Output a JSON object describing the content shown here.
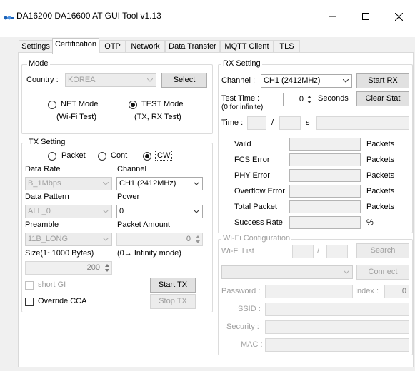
{
  "window": {
    "title": "DA16200 DA16600 AT GUI Tool v1.13",
    "logo_text": "dialog",
    "minimize": "minimize-icon",
    "maximize": "maximize-icon",
    "close": "close-icon"
  },
  "tabs": [
    "Settings",
    "Certification",
    "OTP",
    "Network",
    "Data Transfer",
    "MQTT Client",
    "TLS"
  ],
  "active_tab": "Certification",
  "mode": {
    "title": "Mode",
    "country_label": "Country :",
    "country_value": "KOREA",
    "select_button": "Select",
    "net_mode": "NET Mode",
    "net_mode_sub": "(Wi-Fi Test)",
    "test_mode": "TEST Mode",
    "test_mode_sub": "(TX, RX Test)",
    "selected": "TEST Mode"
  },
  "tx": {
    "title": "TX Setting",
    "type_options": [
      "Packet",
      "Cont",
      "CW"
    ],
    "type_selected": "CW",
    "data_rate_label": "Data Rate",
    "data_rate_value": "B_1Mbps",
    "channel_label": "Channel",
    "channel_value": "CH1 (2412MHz)",
    "data_pattern_label": "Data Pattern",
    "data_pattern_value": "ALL_0",
    "power_label": "Power",
    "power_value": "0",
    "preamble_label": "Preamble",
    "preamble_value": "11B_LONG",
    "packet_amount_label": "Packet Amount",
    "packet_amount_value": "0",
    "size_label": "Size(1~1000 Bytes)",
    "size_value": "200",
    "infinity_note": "(0→ Infinity mode)",
    "short_gi": "short GI",
    "override_cca": "Override CCA",
    "start_tx": "Start TX",
    "stop_tx": "Stop TX"
  },
  "rx": {
    "title": "RX Setting",
    "channel_label": "Channel :",
    "channel_value": "CH1 (2412MHz)",
    "start_rx": "Start RX",
    "test_time_label": "Test Time :",
    "test_time_sub": "(0 for infinite)",
    "test_time_value": "0",
    "seconds": "Seconds",
    "clear_stat": "Clear Stat",
    "time_label": "Time :",
    "time_sep": "/",
    "time_unit": "s",
    "stats": [
      {
        "label": "Vaild",
        "unit": "Packets"
      },
      {
        "label": "FCS Error",
        "unit": "Packets"
      },
      {
        "label": "PHY Error",
        "unit": "Packets"
      },
      {
        "label": "Overflow Error",
        "unit": "Packets"
      },
      {
        "label": "Total Packet",
        "unit": "Packets"
      },
      {
        "label": "Success Rate",
        "unit": "%"
      }
    ]
  },
  "wifi": {
    "title": "Wi-Fi Configuration",
    "list_label": "Wi-Fi List",
    "list_sep": "/",
    "search": "Search",
    "connect": "Connect",
    "password_label": "Password :",
    "index_label": "Index :",
    "index_value": "0",
    "ssid_label": "SSID :",
    "security_label": "Security :",
    "mac_label": "MAC :"
  }
}
